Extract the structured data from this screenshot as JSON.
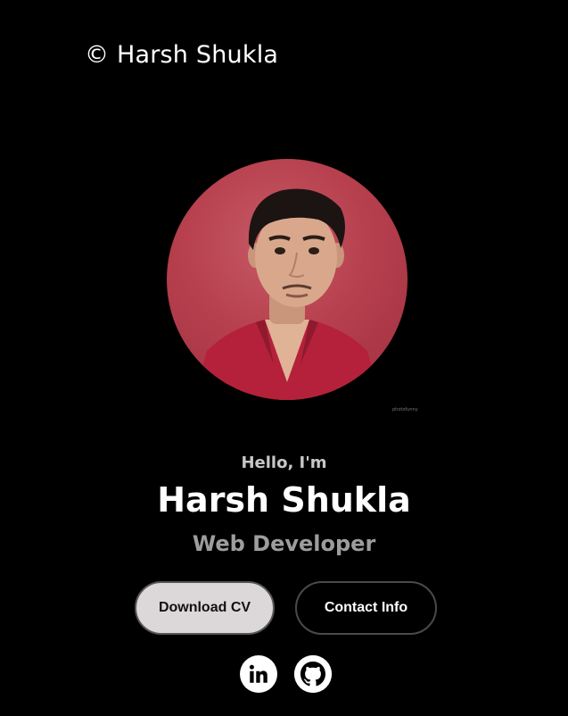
{
  "header": {
    "logo_text": "© Harsh Shukla"
  },
  "profile": {
    "photo_icon": "profile-photo",
    "photo_watermark": "photofunny",
    "intro": "Hello, I'm",
    "name": "Harsh Shukla",
    "role": "Web Developer"
  },
  "buttons": {
    "download_label": "Download CV",
    "contact_label": "Contact Info"
  },
  "socials": [
    {
      "icon": "linkedin-icon"
    },
    {
      "icon": "github-icon"
    }
  ],
  "colors": {
    "background": "#000000",
    "primary_button_bg": "#dcd7d8",
    "photo_bg": "#b7404e",
    "role_text": "#9d9d9d"
  }
}
